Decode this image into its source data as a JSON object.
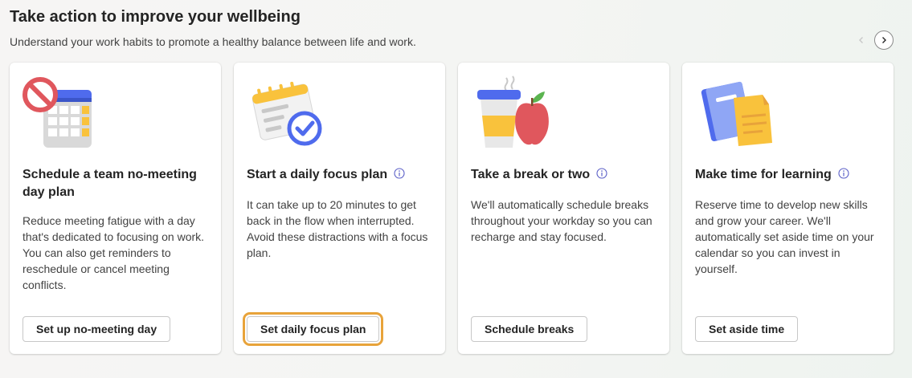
{
  "section": {
    "title": "Take action to improve your wellbeing",
    "subtitle": "Understand your work habits to promote a healthy balance between life and work."
  },
  "nav": {
    "prev_icon": "chevron-left-icon",
    "next_icon": "chevron-right-icon"
  },
  "colors": {
    "focus_outline": "#e8a33a",
    "info_icon": "#5b5fc7",
    "calendar_blue": "#4f6bed",
    "no_sign_red": "#e0575d"
  },
  "cards": [
    {
      "icon": "no-meeting-calendar-icon",
      "title": "Schedule a team no-meeting day plan",
      "body": "Reduce meeting fatigue with a day that's dedicated to focusing on work. You can also get reminders to reschedule or cancel meeting conflicts.",
      "button": "Set up no-meeting day",
      "has_info": false
    },
    {
      "icon": "focus-plan-calendar-icon",
      "title": "Start a daily focus plan",
      "body": "It can take up to 20 minutes to get back in the flow when interrupted. Avoid these distractions with a focus plan.",
      "button": "Set daily focus plan",
      "has_info": true,
      "focused": true
    },
    {
      "icon": "coffee-apple-icon",
      "title": "Take a break or two",
      "body": "We'll automatically schedule breaks throughout your workday so you can recharge and stay focused.",
      "button": "Schedule breaks",
      "has_info": true
    },
    {
      "icon": "notebook-icon",
      "title": "Make time for learning",
      "body": "Reserve time to develop new skills and grow your career. We'll automatically set aside time on your calendar so you can invest in yourself.",
      "button": "Set aside time",
      "has_info": true
    }
  ]
}
